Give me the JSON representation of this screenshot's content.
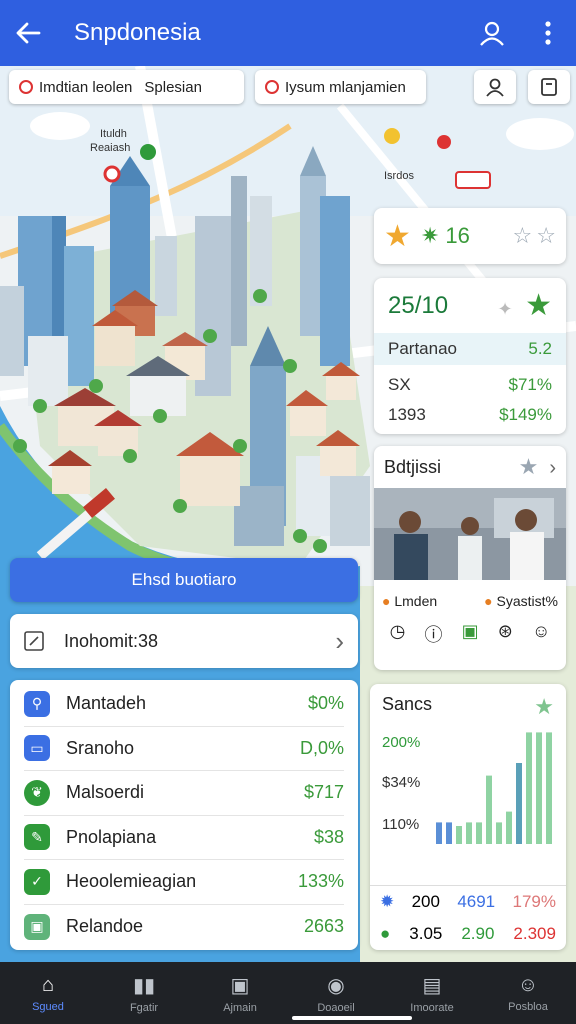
{
  "header": {
    "title": "Snpdonesia"
  },
  "chips": {
    "left": "Imdtian leolen",
    "left_extra": "Splesian",
    "right": "Iysum mlanjamien"
  },
  "map_labels": [
    "Ituldh",
    "Reaiash",
    "Isrdos"
  ],
  "rating_card": {
    "value": "16"
  },
  "stats_card": {
    "headline": "25/10",
    "rows": [
      {
        "label": "Partanao",
        "value": "5.2"
      },
      {
        "label": "SX",
        "value": "$71%"
      },
      {
        "label": "1393",
        "value": "$149%"
      }
    ]
  },
  "photo_card": {
    "title": "Bdtjissi",
    "loc_left": "Lmden",
    "loc_right": "Syastist%"
  },
  "chart_card": {
    "title": "Sancs",
    "y_labels": [
      "200%",
      "$34%",
      "110%"
    ],
    "footer": [
      {
        "a": "200",
        "b": "4691",
        "c": "179%"
      },
      {
        "a": "3.05",
        "b": "2.90",
        "c": "2.309"
      }
    ]
  },
  "chart_data": {
    "type": "bar",
    "title": "Sancs",
    "series": [
      {
        "values": [
          0.12,
          0.12,
          0.1,
          0.12,
          0.12,
          0.38,
          0.12,
          0.18,
          0.45,
          0.62,
          0.62,
          0.62
        ]
      }
    ],
    "colors": [
      "#8fd3a3",
      "#5b8fd6",
      "#5aa0b8"
    ]
  },
  "cta": {
    "label": "Ehsd buotiaro"
  },
  "infobar": {
    "label": "Inohomit:38"
  },
  "list": [
    {
      "label": "Mantadeh",
      "value": "$0%",
      "color": "#3b6fe3"
    },
    {
      "label": "Sranoho",
      "value": "D,0%",
      "color": "#3b6fe3"
    },
    {
      "label": "Malsoerdi",
      "value": "$717",
      "color": "#2f9a3a"
    },
    {
      "label": "Pnolapiana",
      "value": "$38",
      "color": "#2f9a3a"
    },
    {
      "label": "Heoolemieagian",
      "value": "133%",
      "color": "#2f9a3a"
    },
    {
      "label": "Relandoe",
      "value": "2663",
      "color": "#5fb37a"
    }
  ],
  "nav": [
    {
      "label": "Sgued",
      "icon": "home-icon"
    },
    {
      "label": "Fgatir",
      "icon": "chart-icon"
    },
    {
      "label": "Ajmain",
      "icon": "photo-icon"
    },
    {
      "label": "Doaoeil",
      "icon": "camera-icon"
    },
    {
      "label": "Imoorate",
      "icon": "save-icon"
    },
    {
      "label": "Posbloa",
      "icon": "user-icon"
    }
  ]
}
